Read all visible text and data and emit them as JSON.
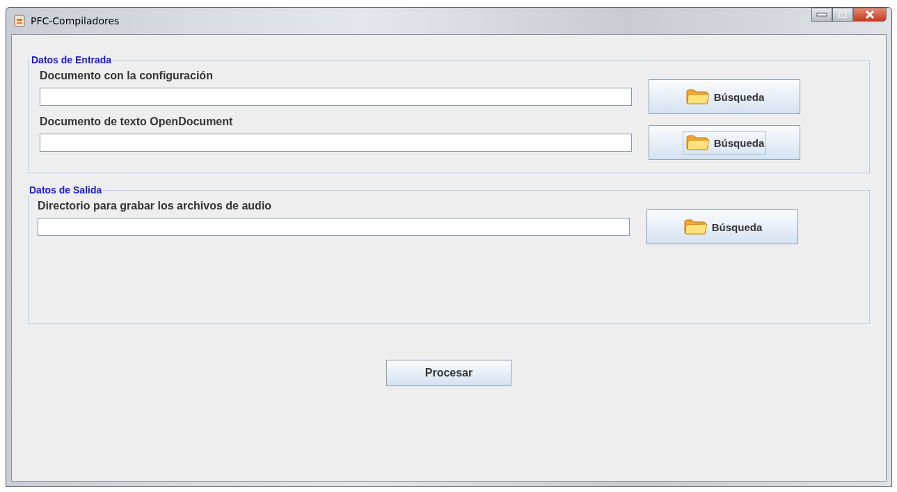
{
  "window": {
    "title": "PFC-Compiladores"
  },
  "sections": [
    {
      "legend": "Datos de Entrada",
      "rows": [
        {
          "label": "Documento con la configuración",
          "button": {
            "label": "Búsqueda",
            "focused": false
          }
        },
        {
          "label": "Documento de texto OpenDocument",
          "button": {
            "label": "Búsqueda",
            "focused": true
          }
        }
      ]
    },
    {
      "legend": "Datos de Salida",
      "rows": [
        {
          "label": "Directorio para grabar los archivos de audio",
          "button": {
            "label": "Búsqueda",
            "focused": false
          }
        }
      ]
    }
  ],
  "process_button": {
    "label": "Procesar"
  }
}
